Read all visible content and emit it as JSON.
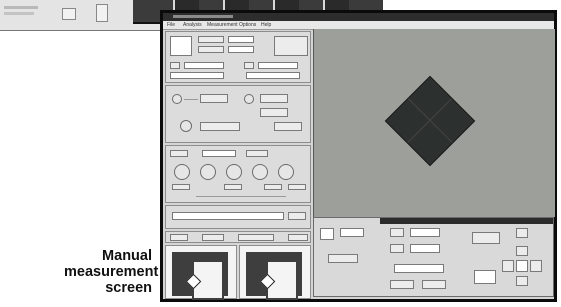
{
  "caption": {
    "line1": "Manual",
    "line2": "measurement",
    "line3": "screen"
  },
  "menu": {
    "items": [
      "File",
      "Analysis",
      "Measurement",
      "Options",
      "Help"
    ]
  },
  "icons": {
    "indentation": "diamond-indentation-icon"
  },
  "colors": {
    "window_border": "#0b0b0b",
    "image_background": "#9d9f9b",
    "indentation": "#2c302e"
  }
}
